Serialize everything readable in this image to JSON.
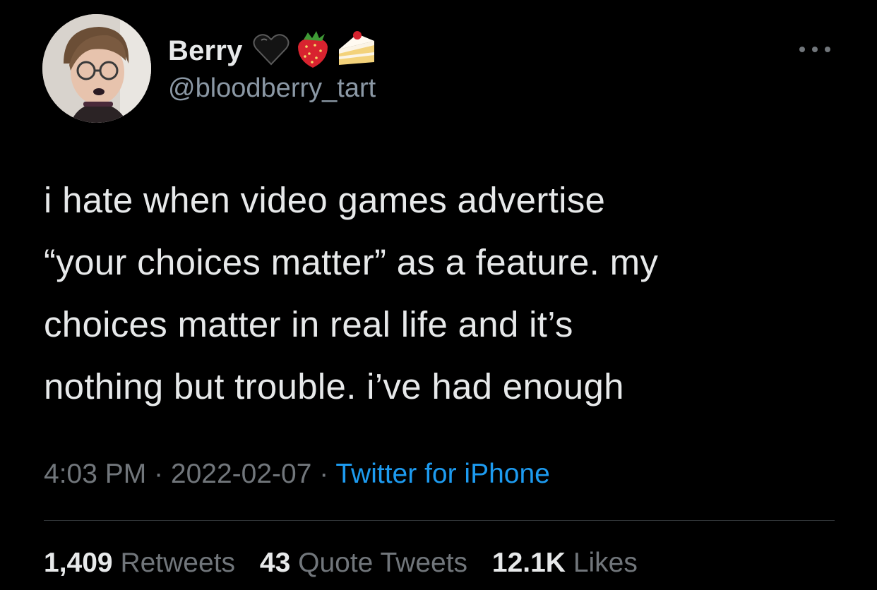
{
  "author": {
    "display_name": "Berry",
    "handle": "@bloodberry_tart",
    "name_emojis": [
      "black-heart-icon",
      "strawberry-icon",
      "shortcake-icon"
    ]
  },
  "tweet": {
    "text": "i hate when video games advertise\n“your choices matter” as a feature. my\nchoices matter in real life and it’s\nnothing but trouble. i’ve had enough"
  },
  "meta": {
    "time": "4:03 PM",
    "separator": " · ",
    "date": "2022-02-07",
    "source": "Twitter for iPhone"
  },
  "stats": {
    "retweets_count": "1,409",
    "retweets_label": "Retweets",
    "quotes_count": "43",
    "quotes_label": "Quote Tweets",
    "likes_count": "12.1K",
    "likes_label": "Likes"
  },
  "colors": {
    "background": "#000000",
    "primary_text": "#e7e9ea",
    "secondary_text": "#71767b",
    "link": "#1d9bf0",
    "divider": "#2f3336"
  }
}
